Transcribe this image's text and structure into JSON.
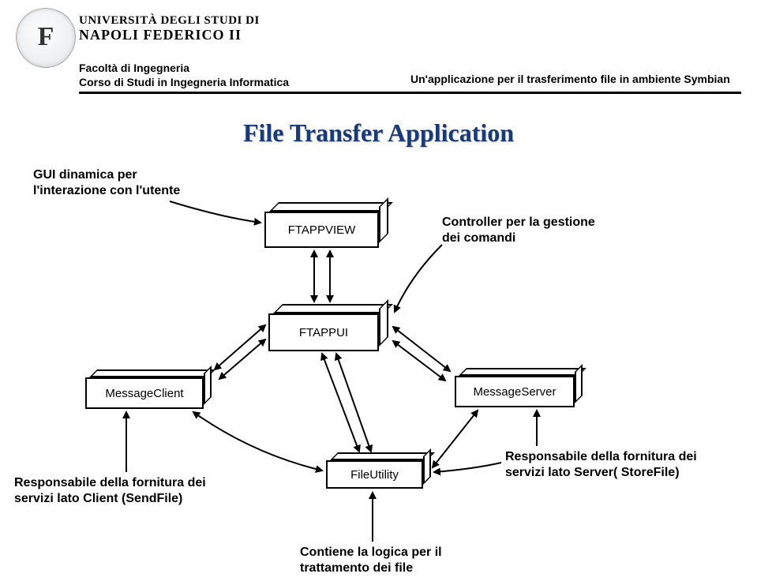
{
  "header": {
    "uni_line1": "UNIVERSITÀ DEGLI STUDI DI",
    "uni_line2": "NAPOLI FEDERICO II",
    "faculty": "Facoltà di Ingegneria",
    "course": "Corso di Studi in Ingegneria Informatica",
    "app_desc": "Un'applicazione per il trasferimento file in ambiente Symbian"
  },
  "title": "File Transfer Application",
  "boxes": {
    "ftappview": "FTAPPVIEW",
    "ftappui": "FTAPPUI",
    "message_client": "MessageClient",
    "message_server": "MessageServer",
    "file_utility": "FileUtility"
  },
  "annotations": {
    "gui_label_l1": "GUI dinamica per",
    "gui_label_l2": "l'interazione con l'utente",
    "controller_label_l1": "Controller per la gestione",
    "controller_label_l2": "dei comandi",
    "client_label_l1": "Responsabile della fornitura dei",
    "client_label_l2": "servizi lato Client (SendFile)",
    "server_label_l1": "Responsabile della fornitura dei",
    "server_label_l2": "servizi lato Server( StoreFile)",
    "fileutility_label_l1": "Contiene la logica per il",
    "fileutility_label_l2": "trattamento dei file"
  }
}
